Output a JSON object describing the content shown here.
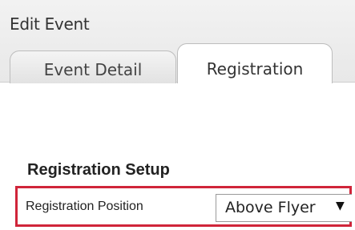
{
  "window": {
    "title": "Edit Event"
  },
  "tabs": [
    {
      "label": "Event Detail",
      "selected": false
    },
    {
      "label": "Registration",
      "selected": true
    }
  ],
  "registration_setup": {
    "section_title": "Registration Setup",
    "position_label": "Registration Position",
    "position_value": "Above Flyer",
    "dropdown_icon": "triangle-down-icon",
    "highlight_color": "#d0253a"
  }
}
